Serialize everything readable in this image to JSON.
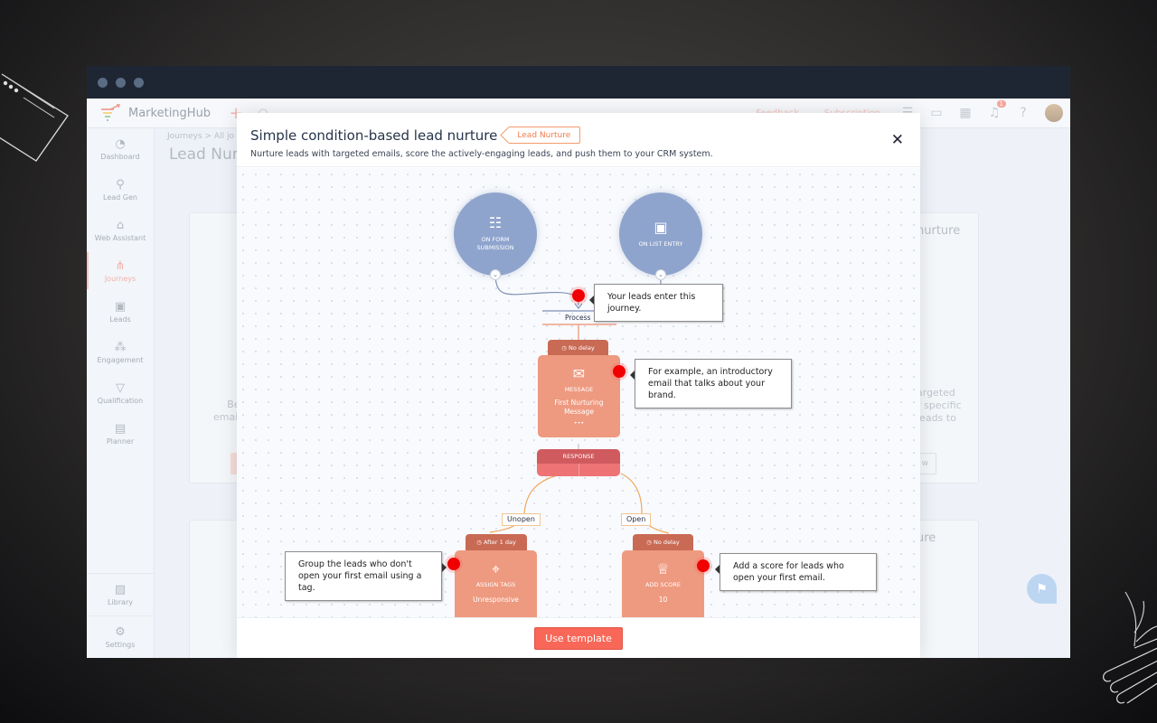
{
  "window": {
    "traffic_lights": 3
  },
  "app": {
    "name": "MarketingHub",
    "topbar": {
      "add_icon": "plus-icon",
      "search_icon": "search-icon",
      "links": [
        "Feedback",
        "Subscription"
      ],
      "icons": [
        "list-icon",
        "folder-icon",
        "calendar-icon",
        "bell-icon",
        "help-icon"
      ],
      "notification_count": "1"
    },
    "sidebar": {
      "items": [
        {
          "label": "Dashboard",
          "icon": "dashboard-icon",
          "glyph": "◔"
        },
        {
          "label": "Lead Gen",
          "icon": "lead-gen-icon",
          "glyph": "⚲"
        },
        {
          "label": "Web Assistant",
          "icon": "web-assistant-icon",
          "glyph": "⌂"
        },
        {
          "label": "Journeys",
          "icon": "journeys-icon",
          "glyph": "⋔",
          "active": true
        },
        {
          "label": "Leads",
          "icon": "leads-icon",
          "glyph": "▣"
        },
        {
          "label": "Engagement",
          "icon": "engagement-icon",
          "glyph": "⁂"
        },
        {
          "label": "Qualification",
          "icon": "funnel-icon",
          "glyph": "▽"
        },
        {
          "label": "Planner",
          "icon": "planner-icon",
          "glyph": "▤"
        }
      ],
      "bottom": [
        {
          "label": "Library",
          "icon": "library-icon",
          "glyph": "▨"
        },
        {
          "label": "Settings",
          "icon": "gear-icon",
          "glyph": "⚙"
        }
      ]
    },
    "main": {
      "breadcrumb": "Journeys  >  All jo",
      "page_title": "Lead Nur",
      "bg_cards": {
        "card1_text": "Begi\nemails,",
        "card2_title": "nurture",
        "card2_text": "argeted\nr specific\nleads to",
        "card2_button": "w",
        "card4_title": "ure"
      }
    }
  },
  "modal": {
    "title": "Simple condition-based lead nurture",
    "tag": "Lead Nurture",
    "subtitle": "Nurture leads with targeted emails, score the actively-engaging leads, and push them to your CRM system.",
    "close_label": "✕",
    "footer_button": "Use template",
    "flow": {
      "triggers": [
        {
          "label": "ON FORM SUBMISSION",
          "icon": "form-icon"
        },
        {
          "label": "ON LIST ENTRY",
          "icon": "contact-list-icon"
        }
      ],
      "process_label": "Process",
      "message_node": {
        "delay": "No delay",
        "type": "MESSAGE",
        "name": "First Nurturing Message",
        "more": "•••"
      },
      "response_label": "RESPONSE",
      "branches": [
        {
          "edge": "Unopen",
          "delay": "After 1 day",
          "type": "ASSIGN TAGS",
          "value": "Unresponsive"
        },
        {
          "edge": "Open",
          "delay": "No delay",
          "type": "ADD SCORE",
          "value": "10"
        }
      ]
    },
    "tooltips": [
      "Your leads enter this journey.",
      "For example, an introductory email that talks about your brand.",
      "Group the leads who don't open your first email using a tag.",
      "Add a score for leads who open your first email."
    ]
  }
}
